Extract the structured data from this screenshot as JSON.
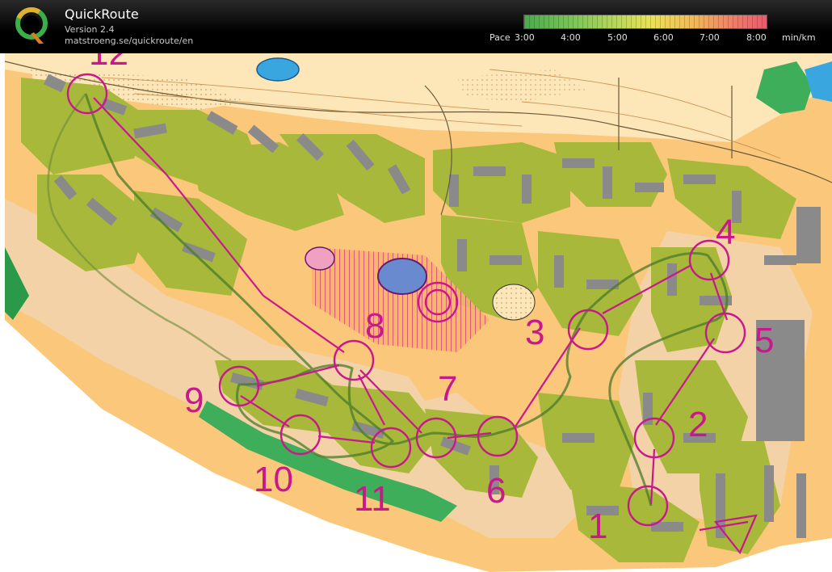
{
  "app": {
    "title": "QuickRoute",
    "version": "Version 2.4",
    "url": "matstroeng.se/quickroute/en"
  },
  "pace_scale": {
    "prefix": "Pace",
    "ticks": [
      "3:00",
      "4:00",
      "5:00",
      "6:00",
      "7:00",
      "8:00"
    ],
    "unit": "min/km"
  },
  "map": {
    "course_color": "#c8188c",
    "control_numbers": [
      "1",
      "2",
      "3",
      "4",
      "5",
      "6",
      "7",
      "8",
      "9",
      "10",
      "11",
      "12"
    ]
  },
  "colors": {
    "header_bg": "#000000",
    "map_open": "#fbc77a",
    "map_rough_open": "#fde6b8",
    "map_paved": "#f2d2a6",
    "map_building": "#8a8a8a",
    "map_vegetation": "#a8b83a",
    "map_green": "#2a9a4a",
    "map_water": "#3aa6e0",
    "route_line": "#5a6a3a"
  }
}
